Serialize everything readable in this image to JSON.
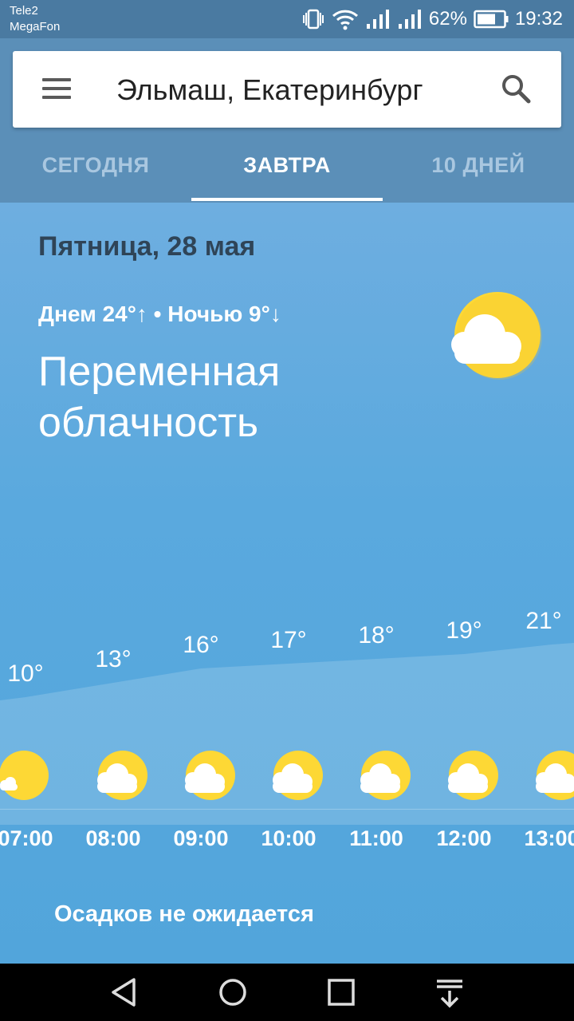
{
  "status_bar": {
    "carrier_1": "Tele2",
    "carrier_2": "MegaFon",
    "battery": "62%",
    "time": "19:32"
  },
  "search": {
    "location": "Эльмаш, Екатеринбург"
  },
  "tabs": [
    {
      "label": "СЕГОДНЯ",
      "active": false
    },
    {
      "label": "ЗАВТРА",
      "active": true
    },
    {
      "label": "10 ДНЕЙ",
      "active": false
    }
  ],
  "forecast": {
    "date": "Пятница, 28 мая",
    "hi_lo": "Днем 24°↑ • Ночью 9°↓",
    "condition": "Переменная облачность",
    "icon": "partly-cloudy-icon"
  },
  "hourly": [
    {
      "time": "07:00",
      "temp": "10°",
      "value": 10,
      "icon": "sun-icon"
    },
    {
      "time": "08:00",
      "temp": "13°",
      "value": 13,
      "icon": "partly-cloudy-icon"
    },
    {
      "time": "09:00",
      "temp": "16°",
      "value": 16,
      "icon": "partly-cloudy-icon"
    },
    {
      "time": "10:00",
      "temp": "17°",
      "value": 17,
      "icon": "partly-cloudy-icon"
    },
    {
      "time": "11:00",
      "temp": "18°",
      "value": 18,
      "icon": "partly-cloudy-icon"
    },
    {
      "time": "12:00",
      "temp": "19°",
      "value": 19,
      "icon": "partly-cloudy-icon"
    },
    {
      "time": "13:00",
      "temp": "21°",
      "value": 21,
      "icon": "partly-cloudy-icon"
    }
  ],
  "precipitation": "Осадков не ожидается",
  "colors": {
    "header": "#5b8fb8",
    "sky": "#5aa9de",
    "sun": "#fdd835",
    "date_text": "#2f4457"
  }
}
